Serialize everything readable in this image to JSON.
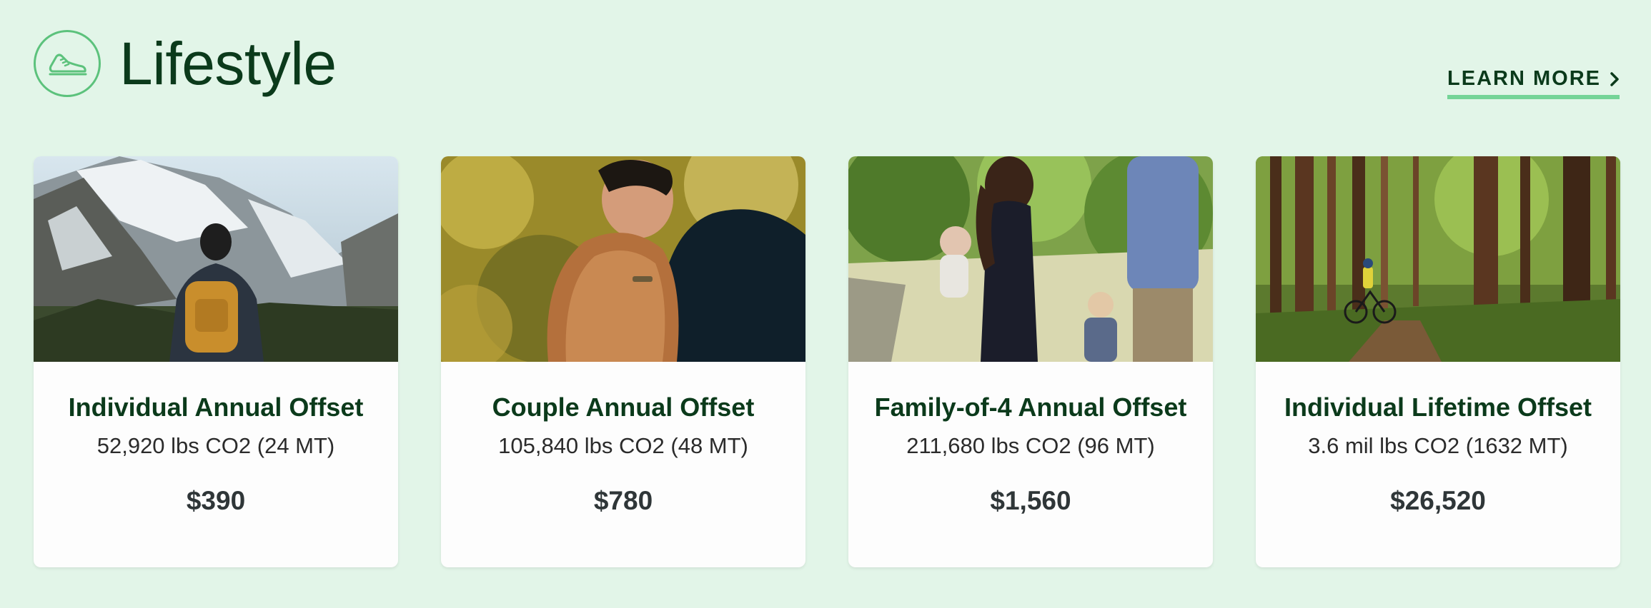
{
  "section": {
    "title": "Lifestyle",
    "icon": "sneaker-icon",
    "learn_more": "LEARN MORE"
  },
  "colors": {
    "background": "#e2f5e8",
    "accent": "#5cc27c",
    "heading": "#0b3a1b",
    "underline": "#74d497"
  },
  "cards": [
    {
      "title": "Individual Annual Offset",
      "subtitle": "52,920 lbs CO2 (24 MT)",
      "price": "$390",
      "image": "hiker-mountains-photo"
    },
    {
      "title": "Couple Annual Offset",
      "subtitle": "105,840 lbs CO2 (48 MT)",
      "price": "$780",
      "image": "couple-embrace-photo"
    },
    {
      "title": "Family-of-4 Annual Offset",
      "subtitle": "211,680 lbs CO2 (96 MT)",
      "price": "$1,560",
      "image": "family-walking-photo"
    },
    {
      "title": "Individual Lifetime Offset",
      "subtitle": "3.6 mil lbs CO2 (1632 MT)",
      "price": "$26,520",
      "image": "forest-cyclist-photo"
    }
  ]
}
